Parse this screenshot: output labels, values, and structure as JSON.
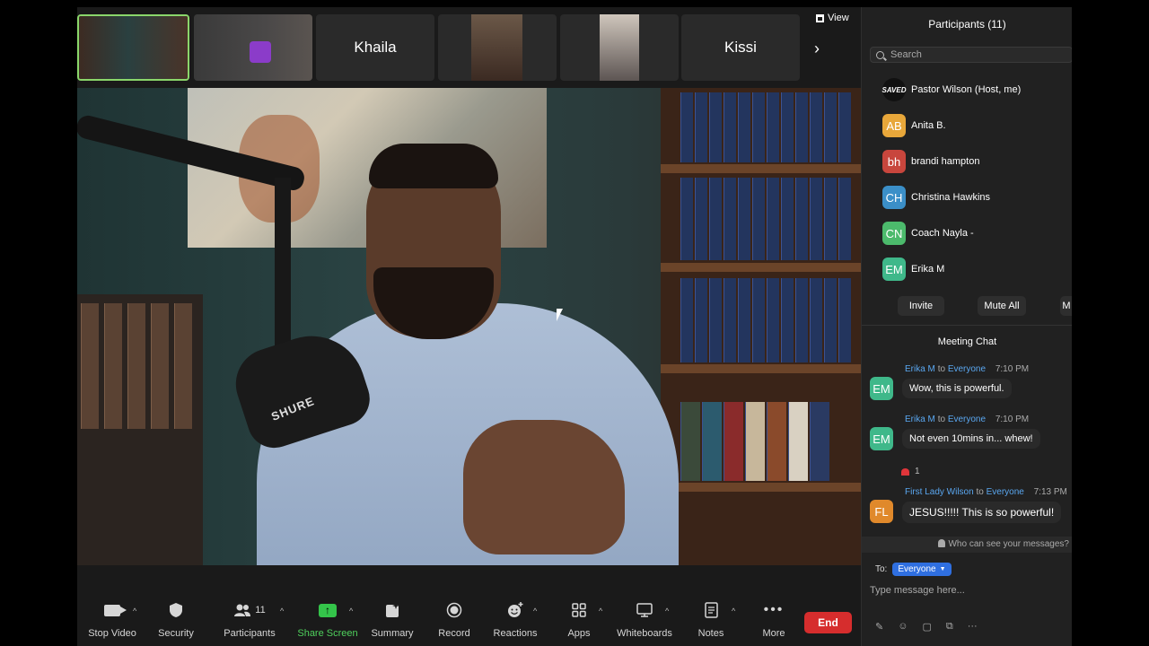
{
  "strip": {
    "thumbnails": [
      {
        "name": ""
      },
      {
        "name": ""
      },
      {
        "name": "Khaila"
      },
      {
        "name": ""
      },
      {
        "name": ""
      },
      {
        "name": "Kissi"
      }
    ],
    "view_label": "View",
    "next_glyph": "›"
  },
  "main_video": {
    "mic_brand": "SHURE"
  },
  "toolbar": {
    "stop_video": "Stop Video",
    "security": "Security",
    "participants": "Participants",
    "participants_count": "11",
    "share_screen": "Share Screen",
    "summary": "Summary",
    "record": "Record",
    "reactions": "Reactions",
    "apps": "Apps",
    "whiteboards": "Whiteboards",
    "notes": "Notes",
    "more": "More",
    "end": "End",
    "caret": "^"
  },
  "participants_panel": {
    "title": "Participants (11)",
    "search_placeholder": "Search",
    "items": [
      {
        "initials": "SAVED",
        "name": "Pastor Wilson (Host, me)",
        "color": "#111111"
      },
      {
        "initials": "AB",
        "name": "Anita B.",
        "color": "#e8a73a"
      },
      {
        "initials": "bh",
        "name": "brandi hampton",
        "color": "#c8463d"
      },
      {
        "initials": "CH",
        "name": "Christina Hawkins",
        "color": "#3b8fc8"
      },
      {
        "initials": "CN",
        "name": "Coach Nayla -",
        "color": "#4cba6c"
      },
      {
        "initials": "EM",
        "name": "Erika M",
        "color": "#3fb88a"
      }
    ],
    "invite": "Invite",
    "mute_all": "Mute All",
    "more_short": "M"
  },
  "chat": {
    "title": "Meeting Chat",
    "to_word": "to",
    "messages": [
      {
        "initials": "EM",
        "sender": "Erika M",
        "recipient": "Everyone",
        "time": "7:10 PM",
        "text": "Wow, this is powerful.",
        "color": "#3fb88a"
      },
      {
        "initials": "EM",
        "sender": "Erika M",
        "recipient": "Everyone",
        "time": "7:10 PM",
        "text": "Not even 10mins in... whew!",
        "color": "#3fb88a"
      },
      {
        "initials": "FL",
        "sender": "First Lady Wilson",
        "recipient": "Everyone",
        "time": "7:13 PM",
        "text": "JESUS!!!!! This is so powerful!",
        "color": "#e0892b"
      }
    ],
    "reaction_count": "1",
    "privacy_text": "Who can see your messages?",
    "to_label": "To:",
    "to_value": "Everyone",
    "compose_placeholder": "Type message here..."
  }
}
